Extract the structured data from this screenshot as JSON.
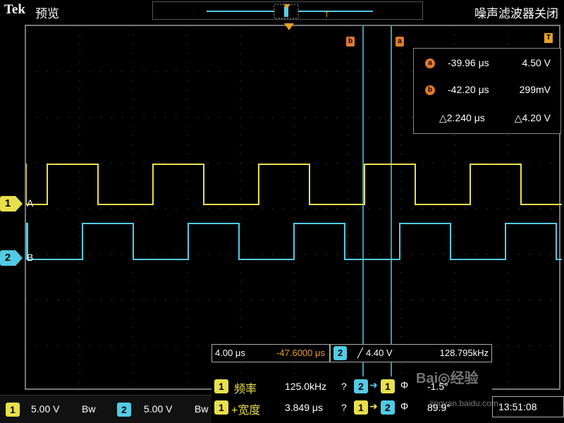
{
  "header": {
    "brand": "Tek",
    "status": "预览",
    "mode": "噪声滤波器关闭"
  },
  "channels": [
    {
      "id": "1",
      "letter": "A",
      "color": "#e8e04b"
    },
    {
      "id": "2",
      "letter": "B",
      "color": "#52cbe5"
    }
  ],
  "cursor_markers": {
    "b_label": "b",
    "a_label": "a",
    "trigger_marker": "T"
  },
  "cursor_readout": {
    "a": {
      "icon": "a",
      "time": "-39.96 μs",
      "value": "4.50 V"
    },
    "b": {
      "icon": "b",
      "time": "-42.20 μs",
      "value": "299mV"
    },
    "delta": {
      "time": "△2.240 μs",
      "value": "△4.20 V"
    }
  },
  "timebase": {
    "div": "4.00 μs",
    "position": "-47.6000 μs"
  },
  "trigger": {
    "channel": "2",
    "slope": "╱",
    "level": "4.40 V",
    "frequency": "128.795kHz"
  },
  "measurements": [
    {
      "src": "1",
      "name": "频率",
      "value": "125.0kHz",
      "q": "?",
      "from": "2",
      "to": "1",
      "param": "Φ",
      "result": "-1.5°"
    },
    {
      "src": "1",
      "name": "+宽度",
      "value": "3.849 μs",
      "q": "?",
      "from": "1",
      "to": "2",
      "param": "Φ",
      "result": "89.9°"
    }
  ],
  "vertical": [
    {
      "ch": "1",
      "scale": "5.00 V",
      "bw": "Bw"
    },
    {
      "ch": "2",
      "scale": "5.00 V",
      "bw": "Bw"
    }
  ],
  "clock": "13:51:08",
  "watermark": {
    "text": "Bai◎经验",
    "url": "jingyan.baidu.com"
  }
}
